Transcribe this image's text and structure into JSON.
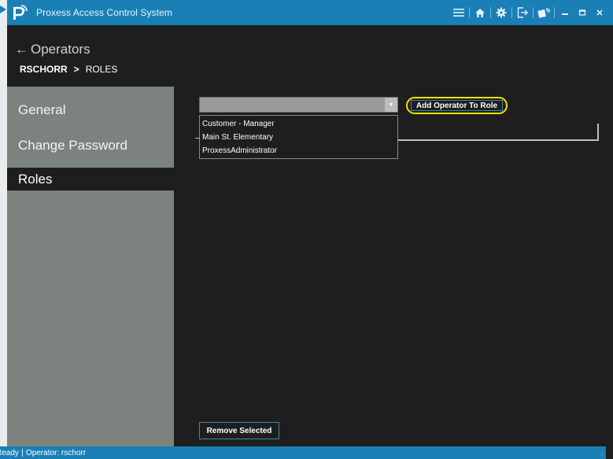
{
  "app": {
    "title": "Proxess Access Control System",
    "accent_color": "#1a7fb5",
    "titlebar_icons": [
      "menu-icon",
      "home-icon",
      "settings-icon",
      "logout-icon",
      "badge-icon",
      "minimize-icon",
      "maximize-icon",
      "close-icon"
    ]
  },
  "header": {
    "back_label": "Operators",
    "breadcrumb": {
      "user": "RSCHORR",
      "separator": ">",
      "section": "ROLES"
    }
  },
  "sidebar": {
    "items": [
      {
        "label": "General",
        "active": false
      },
      {
        "label": "Change Password",
        "active": false
      },
      {
        "label": "Roles",
        "active": true
      }
    ]
  },
  "roles": {
    "selected_value": "",
    "options": [
      "Customer - Manager",
      "Main St. Elementary",
      "ProxessAdministrator"
    ],
    "add_button_label": "Add Operator To Role",
    "remove_button_label": "Remove Selected",
    "highlight_color": "#f2e100"
  },
  "status": {
    "state": "Ready",
    "operator_label": "Operator: rschorr"
  }
}
